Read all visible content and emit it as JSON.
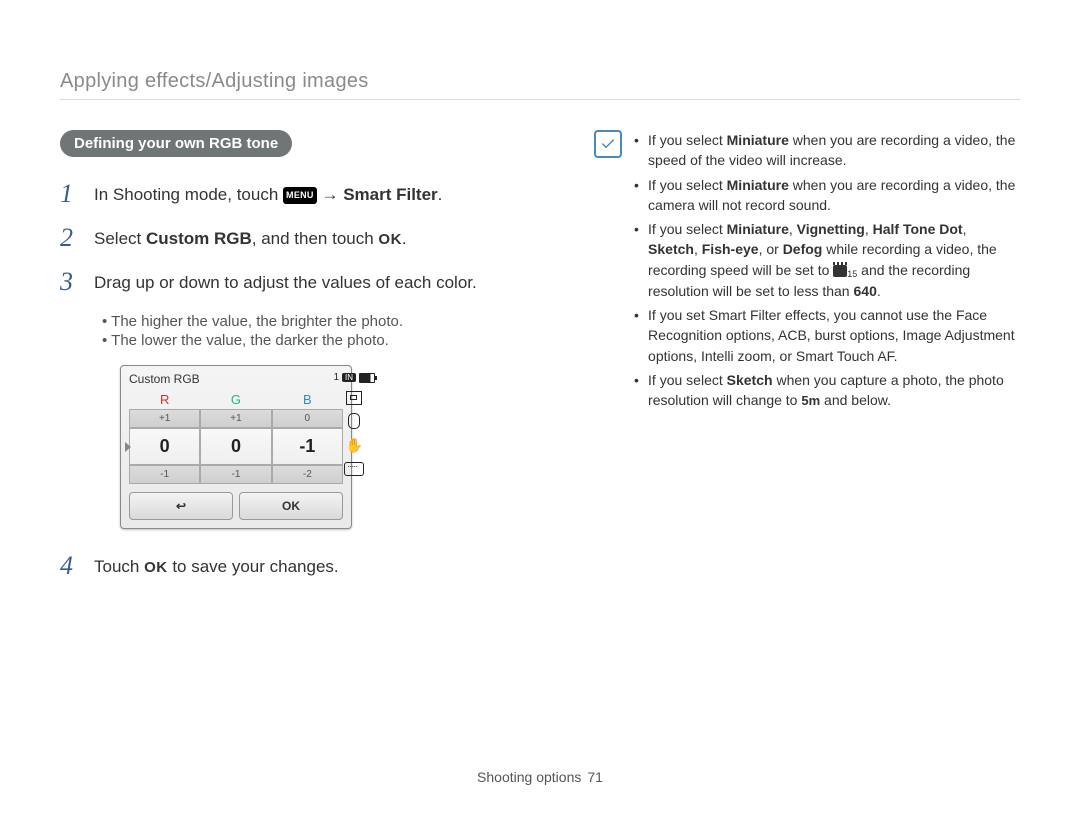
{
  "breadcrumb": "Applying effects/Adjusting images",
  "section_pill": "Defining your own RGB tone",
  "steps": {
    "1": {
      "pre": "In Shooting mode, touch ",
      "menu_chip": "MENU",
      "arrow": " → ",
      "bold": "Smart Filter",
      "post": "."
    },
    "2": {
      "pre": "Select ",
      "bold": "Custom RGB",
      "post": ", and then touch ",
      "ok": "OK",
      "tail": "."
    },
    "3": {
      "text": "Drag up or down to adjust the values of each color."
    },
    "4": {
      "pre": "Touch ",
      "ok": "OK",
      "post": " to save your changes."
    }
  },
  "sub": {
    "a": "The higher the value, the brighter the photo.",
    "b": "The lower the value, the darker the photo."
  },
  "lcd": {
    "title": "Custom RGB",
    "heads": {
      "r": "R",
      "g": "G",
      "b": "B"
    },
    "rows": {
      "top": [
        "+1",
        "+1",
        "0"
      ],
      "mid": [
        "0",
        "0",
        "-1"
      ],
      "bot": [
        "-1",
        "-1",
        "-2"
      ]
    },
    "back": "↩",
    "ok": "OK",
    "side": {
      "count": "1",
      "in": "IN"
    }
  },
  "notes": {
    "n1a": "If you select ",
    "n1b": "Miniature",
    "n1c": " when you are recording a video, the speed of the video will increase.",
    "n2a": "If you select ",
    "n2b": "Miniature",
    "n2c": " when you are recording a video, the camera will not record sound.",
    "n3a": "If you select ",
    "n3b": "Miniature",
    "n3c": ", ",
    "n3d": "Vignetting",
    "n3e": ", ",
    "n3f": "Half Tone Dot",
    "n3g": ", ",
    "n3h": "Sketch",
    "n3i": ", ",
    "n3j": "Fish-eye",
    "n3k": ", or ",
    "n3l": "Defog",
    "n3m": " while recording a video, the recording speed will be set to ",
    "n3n": " and the recording resolution will be set to less than ",
    "n3o": "640",
    "n3p": ".",
    "n3sub": "15",
    "n4": "If you set Smart Filter effects, you cannot use the Face Recognition options, ACB, burst options, Image Adjustment options, Intelli zoom, or Smart Touch AF.",
    "n5a": "If you select ",
    "n5b": "Sketch",
    "n5c": " when you capture a photo, the photo resolution will change to ",
    "n5d": "5m",
    "n5e": " and below."
  },
  "footer": {
    "label": "Shooting options",
    "page": "71"
  }
}
